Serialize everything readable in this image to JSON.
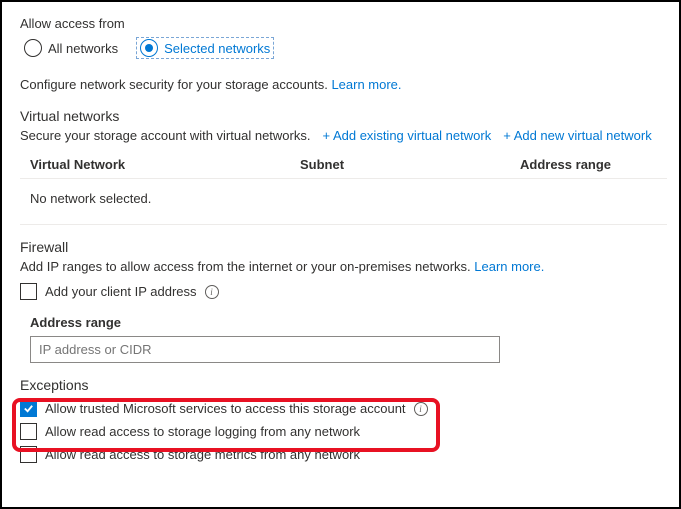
{
  "access": {
    "title": "Allow access from",
    "options": {
      "all": "All networks",
      "selected": "Selected networks"
    }
  },
  "configure": {
    "text": "Configure network security for your storage accounts. ",
    "learn_more": "Learn more."
  },
  "virtual_networks": {
    "heading": "Virtual networks",
    "desc": "Secure your storage account with virtual networks.",
    "add_existing": "+ Add existing virtual network",
    "add_new": "+ Add new virtual network",
    "columns": {
      "vn": "Virtual Network",
      "subnet": "Subnet",
      "range": "Address range"
    },
    "empty": "No network selected."
  },
  "firewall": {
    "heading": "Firewall",
    "desc": "Add IP ranges to allow access from the internet or your on-premises networks. ",
    "learn_more": "Learn more.",
    "add_client_ip": "Add your client IP address",
    "address_range_label": "Address range",
    "placeholder": "IP address or CIDR"
  },
  "exceptions": {
    "heading": "Exceptions",
    "opt_trusted": "Allow trusted Microsoft services to access this storage account",
    "opt_logging": "Allow read access to storage logging from any network",
    "opt_metrics": "Allow read access to storage metrics from any network"
  }
}
